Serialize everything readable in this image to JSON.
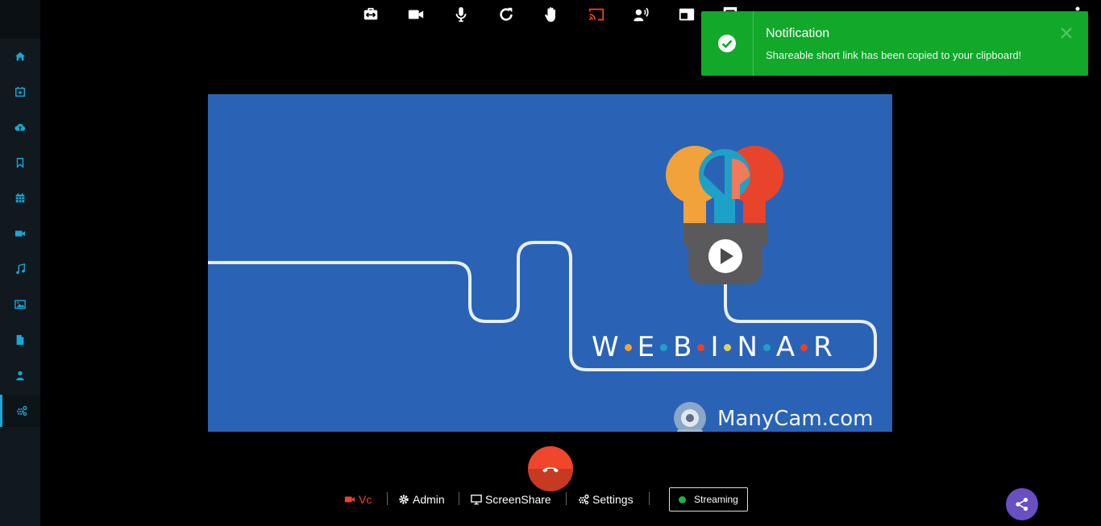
{
  "sidebar": {
    "items": [
      {
        "name": "home-icon"
      },
      {
        "name": "calendar-plus-icon"
      },
      {
        "name": "cloud-upload-icon"
      },
      {
        "name": "bookmark-icon"
      },
      {
        "name": "calendar-icon"
      },
      {
        "name": "video-camera-icon"
      },
      {
        "name": "music-icon"
      },
      {
        "name": "image-icon"
      },
      {
        "name": "file-icon"
      },
      {
        "name": "user-icon"
      },
      {
        "name": "cogs-icon",
        "active": true
      }
    ],
    "accent": "#1aa6d6"
  },
  "toolbar": {
    "buttons": [
      "swap-layout-icon",
      "video-camera-icon",
      "microphone-icon",
      "refresh-icon",
      "raise-hand-icon",
      "cast-icon",
      "speaker-icon",
      "pip-icon",
      "whiteboard-icon"
    ],
    "cast_color": "#e8432b"
  },
  "notification": {
    "title": "Notification",
    "message": "Shareable short link has been copied to your clipboard!",
    "bg_color": "#12a82a"
  },
  "video": {
    "webinar_letters": [
      "W",
      "E",
      "B",
      "I",
      "N",
      "A",
      "R"
    ],
    "dot_colors": [
      "#f2a23a",
      "#1da1c7",
      "#e8432b",
      "#d7d35c",
      "#1da1c7",
      "#e8432b"
    ],
    "watermark": "ManyCam.com"
  },
  "bottom_bar": {
    "vc_label": "Vc",
    "admin_label": "Admin",
    "screenshare_label": "ScreenShare",
    "settings_label": "Settings",
    "streaming_label": "Streaming",
    "vc_color": "#e8432b",
    "streaming_dot_color": "#1bb24a"
  },
  "share_color": "#6a4fc3",
  "end_call_color": "#f0462b"
}
